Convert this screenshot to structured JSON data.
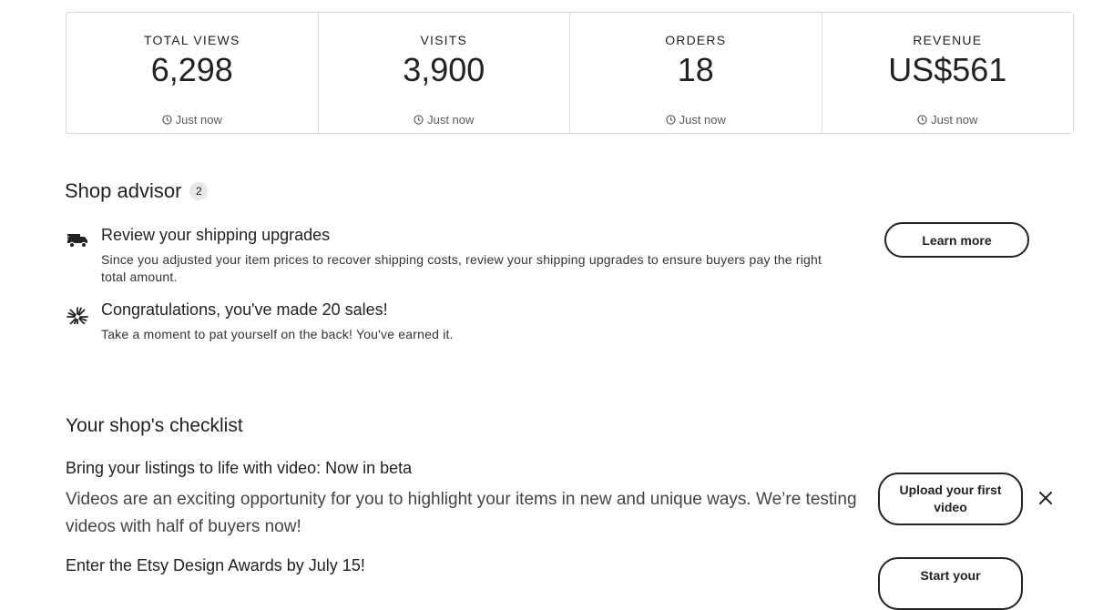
{
  "stats": [
    {
      "label": "TOTAL VIEWS",
      "value": "6,298",
      "updated": "Just now"
    },
    {
      "label": "VISITS",
      "value": "3,900",
      "updated": "Just now"
    },
    {
      "label": "ORDERS",
      "value": "18",
      "updated": "Just now"
    },
    {
      "label": "REVENUE",
      "value": "US$561",
      "updated": "Just now"
    }
  ],
  "advisor": {
    "title": "Shop advisor",
    "count": "2",
    "items": [
      {
        "icon": "truck-icon",
        "title": "Review your shipping upgrades",
        "description": "Since you adjusted your item prices to recover shipping costs, review your shipping upgrades to ensure buyers pay the right total amount.",
        "action": "Learn more"
      },
      {
        "icon": "celebration-burst-icon",
        "title": "Congratulations, you've made 20 sales!",
        "description": "Take a moment to pat yourself on the back! You've earned it."
      }
    ]
  },
  "checklist": {
    "title": "Your shop's checklist",
    "tasks": [
      {
        "title": "Bring your listings to life with video: Now in beta",
        "description": "Videos are an exciting opportunity for you to highlight your items in new and unique ways. We’re testing videos with half of buyers now!",
        "action": "Upload your first video"
      },
      {
        "title": "Enter the Etsy Design Awards by July 15!",
        "action": "Start your"
      }
    ]
  }
}
